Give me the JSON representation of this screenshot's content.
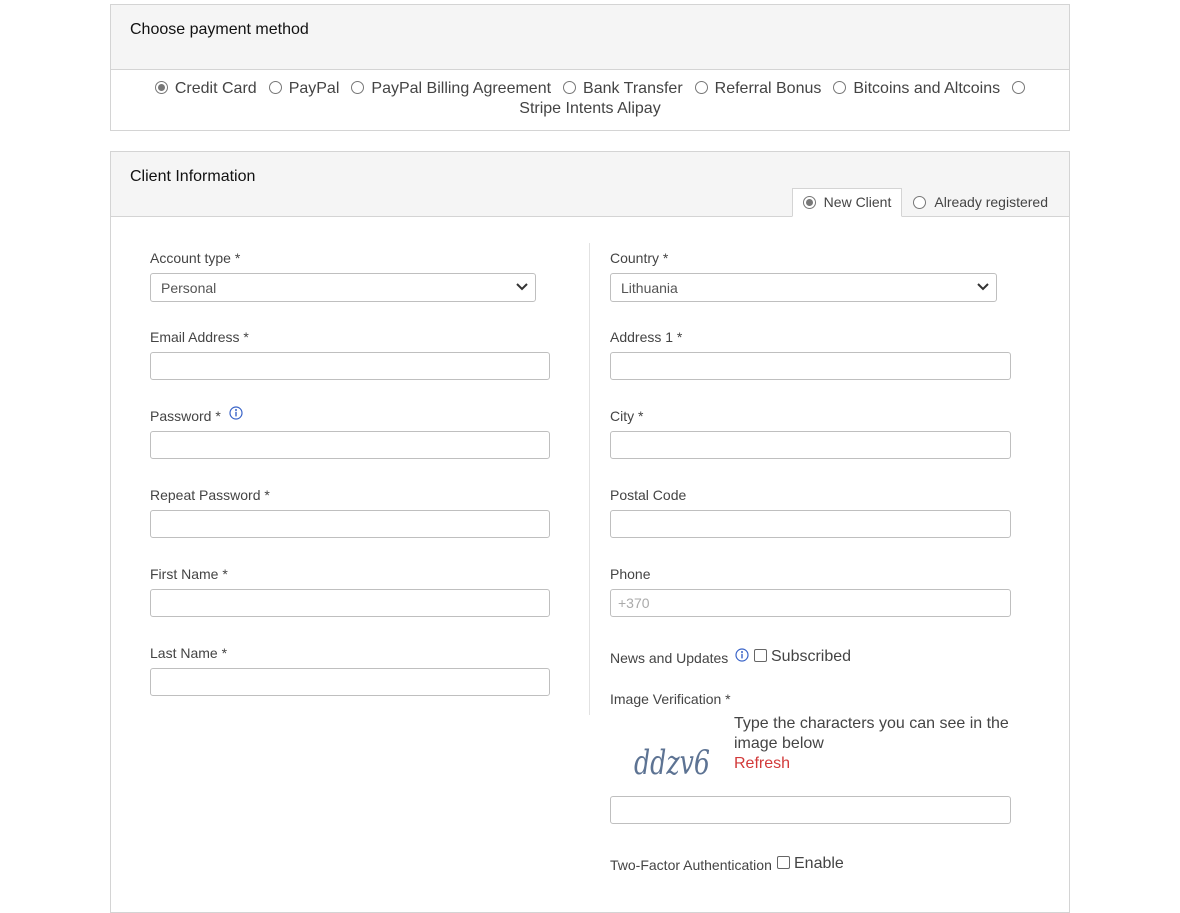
{
  "payment": {
    "title": "Choose payment method",
    "methods": [
      {
        "label": "Credit Card",
        "selected": true
      },
      {
        "label": "PayPal",
        "selected": false
      },
      {
        "label": "PayPal Billing Agreement",
        "selected": false
      },
      {
        "label": "Bank Transfer",
        "selected": false
      },
      {
        "label": "Referral Bonus",
        "selected": false
      },
      {
        "label": "Bitcoins and Altcoins",
        "selected": false
      },
      {
        "label": "Stripe Intents Alipay",
        "selected": false
      }
    ]
  },
  "client": {
    "title": "Client Information",
    "tabs": [
      {
        "label": "New Client",
        "selected": true
      },
      {
        "label": "Already registered",
        "selected": false
      }
    ]
  },
  "form": {
    "account_type": {
      "label": "Account type *",
      "value": "Personal"
    },
    "email": {
      "label": "Email Address *"
    },
    "password": {
      "label": "Password *"
    },
    "repeat_password": {
      "label": "Repeat Password *"
    },
    "first_name": {
      "label": "First Name *"
    },
    "last_name": {
      "label": "Last Name *"
    },
    "country": {
      "label": "Country *",
      "value": "Lithuania"
    },
    "address1": {
      "label": "Address 1 *"
    },
    "city": {
      "label": "City *"
    },
    "postal_code": {
      "label": "Postal Code"
    },
    "phone": {
      "label": "Phone",
      "placeholder": "+370"
    },
    "news": {
      "label": "News and Updates",
      "checkbox_label": "Subscribed"
    },
    "captcha": {
      "label": "Image Verification *",
      "instructions": "Type the characters you can see in the image below",
      "refresh_label": "Refresh",
      "image_text": "ddzv6"
    },
    "two_factor": {
      "label": "Two-Factor Authentication",
      "checkbox_label": "Enable"
    }
  }
}
